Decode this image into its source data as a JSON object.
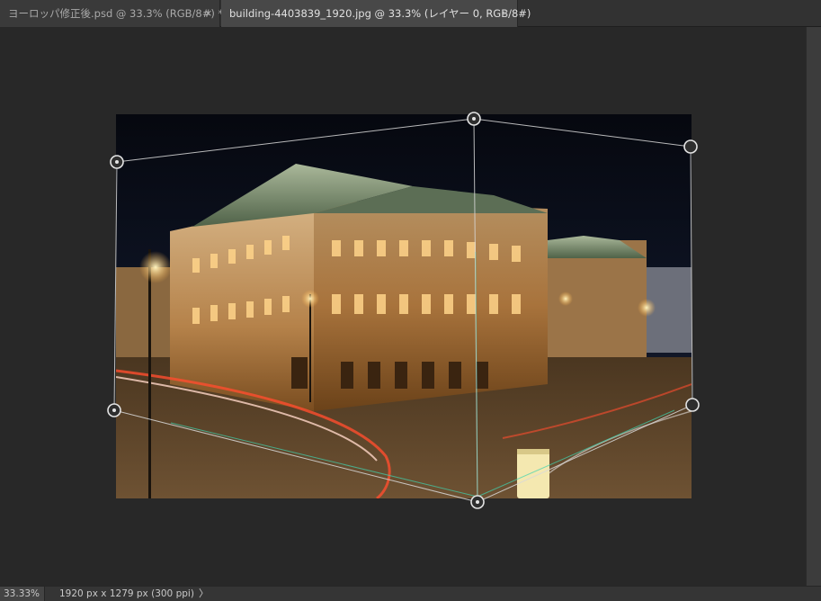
{
  "tabs": [
    {
      "label": "ヨーロッパ修正後.psd @ 33.3% (RGB/8#) *",
      "close": "×"
    },
    {
      "label": "building-4403839_1920.jpg @ 33.3% (レイヤー 0, RGB/8#)",
      "close": "×"
    }
  ],
  "status": {
    "zoom": "33.33%",
    "doc_info": "1920 px x 1279 px (300 ppi)",
    "chevron": "〉"
  },
  "colors": {
    "workspace": "#282828",
    "tab_active": "#484848",
    "tab_inactive": "#3a3a3a",
    "handle": "#dcdcdc"
  }
}
